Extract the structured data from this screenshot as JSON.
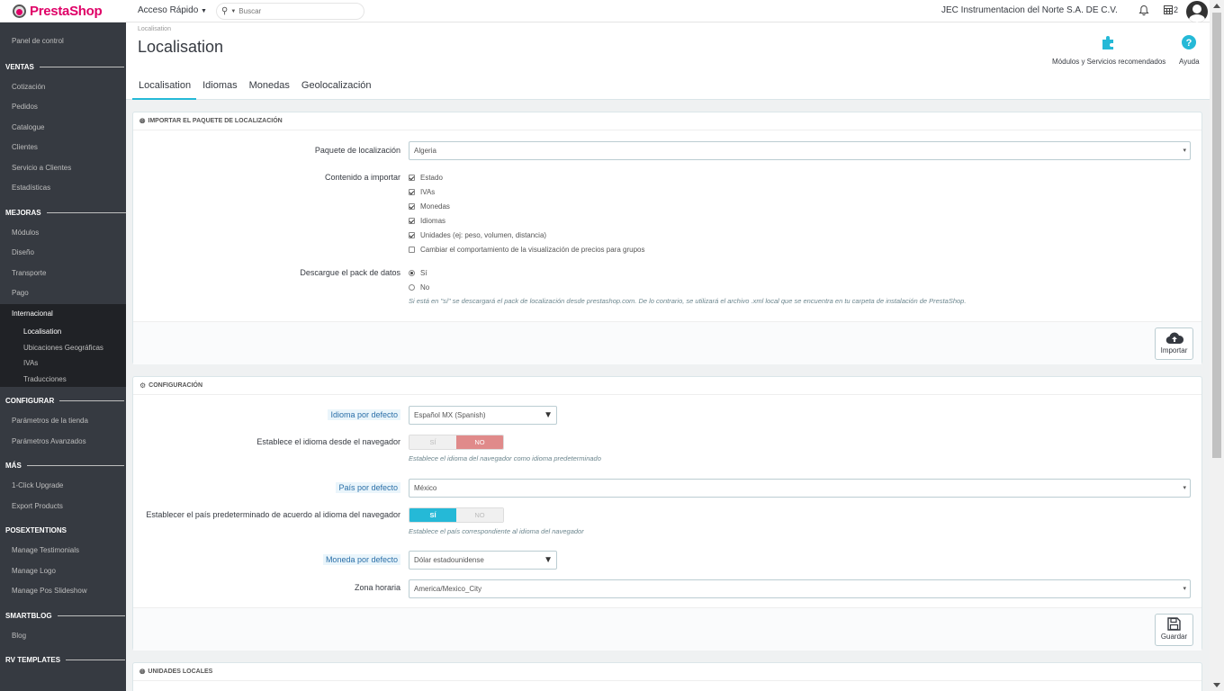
{
  "header": {
    "logo_text": "PrestaShop",
    "quick_access": "Acceso Rápido",
    "search_placeholder": "Buscar",
    "shop_name": "JEC Instrumentacion del Norte S.A. DE C.V.",
    "cart_count": "2"
  },
  "sidebar": {
    "dashboard": "Panel de control",
    "sections": [
      {
        "title": "VENTAS",
        "items": [
          "Cotización",
          "Pedidos",
          "Catalogue",
          "Clientes",
          "Servicio a Clientes",
          "Estadísticas"
        ]
      },
      {
        "title": "MEJORAS",
        "items": [
          "Módulos",
          "Diseño",
          "Transporte",
          "Pago"
        ]
      }
    ],
    "active_item": "Internacional",
    "subitems": [
      "Localisation",
      "Ubicaciones Geográficas",
      "IVAs",
      "Traducciones"
    ],
    "sections2": [
      {
        "title": "CONFIGURAR",
        "items": [
          "Parámetros de la tienda",
          "Parámetros Avanzados"
        ]
      },
      {
        "title": "MÁS",
        "items": [
          "1-Click Upgrade",
          "Export Products"
        ]
      },
      {
        "title": "POSEXTENTIONS",
        "items": [
          "Manage Testimonials",
          "Manage Logo",
          "Manage Pos Slideshow"
        ]
      },
      {
        "title": "SMARTBLOG",
        "items": [
          "Blog"
        ]
      },
      {
        "title": "RV TEMPLATES",
        "items": []
      }
    ]
  },
  "page": {
    "breadcrumb": "Localisation",
    "title": "Localisation",
    "toolbar": {
      "modules_label": "Módulos y Servicios recomendados",
      "help_label": "Ayuda"
    },
    "tabs": [
      "Localisation",
      "Idiomas",
      "Monedas",
      "Geolocalización"
    ]
  },
  "import_panel": {
    "heading": "IMPORTAR EL PAQUETE DE LOCALIZACIÓN",
    "pack_label": "Paquete de localización",
    "pack_value": "Algeria",
    "content_label": "Contenido a importar",
    "content_options": [
      {
        "label": "Estado",
        "checked": true
      },
      {
        "label": "IVAs",
        "checked": true
      },
      {
        "label": "Monedas",
        "checked": true
      },
      {
        "label": "Idiomas",
        "checked": true
      },
      {
        "label": "Unidades (ej: peso, volumen, distancia)",
        "checked": true
      },
      {
        "label": "Cambiar el comportamiento de la visualización de precios para grupos",
        "checked": false
      }
    ],
    "download_label": "Descargue el pack de datos",
    "download_yes": "Sí",
    "download_no": "No",
    "download_help": "Si está en \"sí\" se descargará el pack de localización desde prestashop.com. De lo contrario, se utilizará el archivo .xml local que se encuentra en tu carpeta de instalación de PrestaShop.",
    "button": "Importar"
  },
  "config_panel": {
    "heading": "CONFIGURACIÓN",
    "lang_label": "Idioma por defecto",
    "lang_value": "Español MX (Spanish)",
    "browser_lang_label": "Establece el idioma desde el navegador",
    "browser_lang_yes": "SÍ",
    "browser_lang_no": "NO",
    "browser_lang_help": "Establece el idioma del navegador como idioma predeterminado",
    "country_label": "País por defecto",
    "country_value": "México",
    "country_browser_label": "Establecer el país predeterminado de acuerdo al idioma del navegador",
    "country_browser_yes": "SÍ",
    "country_browser_no": "NO",
    "country_browser_help": "Establece el país correspondiente al idioma del navegador",
    "currency_label": "Moneda por defecto",
    "currency_value": "Dólar estadounidense",
    "timezone_label": "Zona horaria",
    "timezone_value": "America/Mexico_City",
    "button": "Guardar"
  },
  "units_panel": {
    "heading": "UNIDADES LOCALES"
  }
}
